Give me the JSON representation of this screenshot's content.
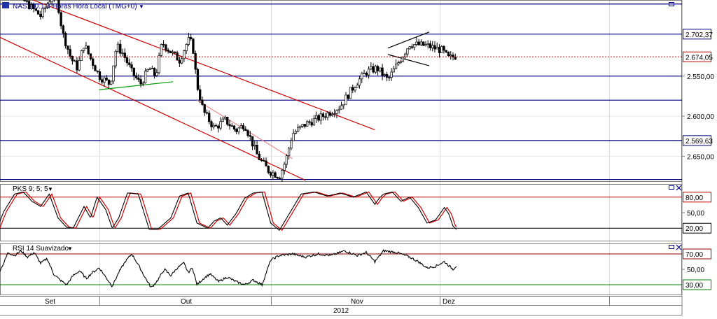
{
  "main_panel": {
    "title": "NAS100.1 4 Horas Hora Local (TMG+0)",
    "price_axis": {
      "ylim": [
        2518,
        2745
      ],
      "ticks": [
        "2.550,00",
        "2.600,00",
        "2.650,00"
      ]
    },
    "h_levels": [
      {
        "value": 2740.0,
        "color": "#000080",
        "label": ""
      },
      {
        "value": 2702.37,
        "color": "#000080",
        "label": "2.702,37"
      },
      {
        "value": 2650.0,
        "color": "#000080",
        "label": ""
      },
      {
        "value": 2620.0,
        "color": "#000080",
        "label": ""
      },
      {
        "value": 2569.63,
        "color": "#000080",
        "label": "2.569,63"
      },
      {
        "value": 2521.0,
        "color": "#000080",
        "label": ""
      }
    ],
    "current_price": {
      "value": 2674.05,
      "label": "2.674,05",
      "color": "#c00000"
    }
  },
  "stochastic_panel": {
    "title": "PKS 9; 5; 5",
    "ylim": [
      0,
      100
    ],
    "levels": [
      {
        "value": 80,
        "label": "80,00",
        "color": "#c00000"
      },
      {
        "value": 20,
        "label": "20,00",
        "color": "#000000"
      }
    ],
    "tick": "50,00",
    "k_color": "#000000",
    "d_color": "#cc0000"
  },
  "rsi_panel": {
    "title": "RSI 14 Suavizado",
    "ylim": [
      20,
      80
    ],
    "levels": [
      {
        "value": 70,
        "label": "70,00",
        "color": "#990000"
      },
      {
        "value": 30,
        "label": "30,00",
        "color": "#008000"
      }
    ],
    "tick": "50,00",
    "line_color": "#000000"
  },
  "time_axis": {
    "months": [
      "Set",
      "Out",
      "Nov",
      "Dez"
    ],
    "year": "2012"
  },
  "chart_data": {
    "type": "candlestick",
    "title": "NAS100.1 4 Horas Hora Local (TMG+0)",
    "ylim": [
      2518,
      2745
    ],
    "price_path": [
      [
        0,
        2780
      ],
      [
        0.06,
        2765
      ],
      [
        0.12,
        2745
      ],
      [
        0.2,
        2725
      ],
      [
        0.23,
        2740
      ],
      [
        0.27,
        2758
      ],
      [
        0.3,
        2705
      ],
      [
        0.34,
        2672
      ],
      [
        0.37,
        2660
      ],
      [
        0.4,
        2690
      ],
      [
        0.43,
        2672
      ],
      [
        0.47,
        2650
      ],
      [
        0.52,
        2640
      ],
      [
        0.55,
        2688
      ],
      [
        0.58,
        2678
      ],
      [
        0.62,
        2655
      ],
      [
        0.66,
        2640
      ],
      [
        0.7,
        2660
      ],
      [
        0.73,
        2650
      ],
      [
        0.76,
        2692
      ],
      [
        0.8,
        2680
      ],
      [
        0.84,
        2670
      ],
      [
        0.88,
        2695
      ],
      [
        0.9,
        2690
      ],
      [
        0.92,
        2640
      ],
      [
        0.95,
        2606
      ],
      [
        1.0,
        2585
      ],
      [
        1.05,
        2595
      ],
      [
        1.1,
        2582
      ],
      [
        1.14,
        2590
      ],
      [
        1.2,
        2550
      ],
      [
        1.25,
        2532
      ],
      [
        1.3,
        2525
      ],
      [
        1.33,
        2545
      ],
      [
        1.36,
        2578
      ],
      [
        1.42,
        2590
      ],
      [
        1.5,
        2600
      ],
      [
        1.58,
        2612
      ],
      [
        1.62,
        2628
      ],
      [
        1.65,
        2640
      ],
      [
        1.7,
        2655
      ],
      [
        1.75,
        2660
      ],
      [
        1.8,
        2645
      ],
      [
        1.85,
        2668
      ],
      [
        1.9,
        2690
      ],
      [
        1.98,
        2688
      ],
      [
        2.05,
        2682
      ],
      [
        2.08,
        2672
      ],
      [
        2.12,
        2676
      ]
    ],
    "drawings": [
      {
        "type": "channel-line",
        "color": "#cc0000",
        "points": [
          [
            0.0,
            2762
          ],
          [
            1.74,
            2583
          ]
        ]
      },
      {
        "type": "channel-line",
        "color": "#cc0000",
        "points": [
          [
            0.0,
            2700
          ],
          [
            1.42,
            2520
          ]
        ]
      },
      {
        "type": "trend-line",
        "color": "#ee8888",
        "points": [
          [
            0.92,
            2620
          ],
          [
            1.36,
            2547
          ]
        ]
      },
      {
        "type": "trend-line",
        "color": "#009900",
        "points": [
          [
            0.47,
            2633
          ],
          [
            0.81,
            2643
          ]
        ]
      },
      {
        "type": "triangle-line",
        "color": "#000000",
        "points": [
          [
            1.8,
            2685
          ],
          [
            1.99,
            2705
          ]
        ]
      },
      {
        "type": "triangle-line",
        "color": "#000000",
        "points": [
          [
            1.8,
            2677
          ],
          [
            1.99,
            2663
          ]
        ]
      }
    ],
    "stochastic_path": [
      [
        0,
        20
      ],
      [
        0.03,
        52
      ],
      [
        0.08,
        86
      ],
      [
        0.12,
        90
      ],
      [
        0.16,
        72
      ],
      [
        0.2,
        62
      ],
      [
        0.24,
        86
      ],
      [
        0.28,
        40
      ],
      [
        0.32,
        22
      ],
      [
        0.35,
        20
      ],
      [
        0.4,
        62
      ],
      [
        0.43,
        40
      ],
      [
        0.46,
        80
      ],
      [
        0.5,
        56
      ],
      [
        0.53,
        20
      ],
      [
        0.56,
        40
      ],
      [
        0.6,
        88
      ],
      [
        0.65,
        86
      ],
      [
        0.7,
        18
      ],
      [
        0.74,
        18
      ],
      [
        0.8,
        40
      ],
      [
        0.84,
        82
      ],
      [
        0.88,
        88
      ],
      [
        0.92,
        30
      ],
      [
        0.97,
        20
      ],
      [
        1.0,
        34
      ],
      [
        1.03,
        40
      ],
      [
        1.06,
        26
      ],
      [
        1.1,
        48
      ],
      [
        1.14,
        78
      ],
      [
        1.18,
        88
      ],
      [
        1.22,
        90
      ],
      [
        1.26,
        30
      ],
      [
        1.3,
        16
      ],
      [
        1.32,
        30
      ],
      [
        1.36,
        58
      ],
      [
        1.4,
        86
      ],
      [
        1.46,
        90
      ],
      [
        1.52,
        82
      ],
      [
        1.58,
        88
      ],
      [
        1.64,
        80
      ],
      [
        1.7,
        90
      ],
      [
        1.74,
        66
      ],
      [
        1.76,
        78
      ],
      [
        1.78,
        86
      ],
      [
        1.82,
        90
      ],
      [
        1.86,
        72
      ],
      [
        1.9,
        80
      ],
      [
        1.94,
        60
      ],
      [
        1.98,
        30
      ],
      [
        2.02,
        36
      ],
      [
        2.06,
        60
      ],
      [
        2.08,
        48
      ],
      [
        2.1,
        24
      ],
      [
        2.12,
        16
      ]
    ],
    "rsi_path": [
      [
        0,
        42
      ],
      [
        0.03,
        58
      ],
      [
        0.05,
        72
      ],
      [
        0.08,
        68
      ],
      [
        0.11,
        74
      ],
      [
        0.14,
        66
      ],
      [
        0.17,
        72
      ],
      [
        0.2,
        58
      ],
      [
        0.23,
        64
      ],
      [
        0.26,
        44
      ],
      [
        0.29,
        36
      ],
      [
        0.32,
        30
      ],
      [
        0.35,
        42
      ],
      [
        0.38,
        48
      ],
      [
        0.41,
        38
      ],
      [
        0.44,
        46
      ],
      [
        0.47,
        52
      ],
      [
        0.5,
        40
      ],
      [
        0.53,
        28
      ],
      [
        0.56,
        46
      ],
      [
        0.59,
        60
      ],
      [
        0.62,
        70
      ],
      [
        0.65,
        56
      ],
      [
        0.68,
        40
      ],
      [
        0.71,
        26
      ],
      [
        0.74,
        36
      ],
      [
        0.77,
        50
      ],
      [
        0.8,
        42
      ],
      [
        0.83,
        52
      ],
      [
        0.86,
        58
      ],
      [
        0.88,
        46
      ],
      [
        0.9,
        52
      ],
      [
        0.92,
        30
      ],
      [
        0.95,
        38
      ],
      [
        0.98,
        44
      ],
      [
        1.02,
        34
      ],
      [
        1.06,
        40
      ],
      [
        1.1,
        34
      ],
      [
        1.14,
        30
      ],
      [
        1.18,
        36
      ],
      [
        1.22,
        30
      ],
      [
        1.26,
        62
      ],
      [
        1.3,
        68
      ],
      [
        1.36,
        70
      ],
      [
        1.42,
        66
      ],
      [
        1.48,
        70
      ],
      [
        1.54,
        68
      ],
      [
        1.6,
        74
      ],
      [
        1.66,
        68
      ],
      [
        1.7,
        72
      ],
      [
        1.74,
        60
      ],
      [
        1.78,
        74
      ],
      [
        1.84,
        72
      ],
      [
        1.9,
        66
      ],
      [
        1.94,
        60
      ],
      [
        1.98,
        52
      ],
      [
        2.02,
        54
      ],
      [
        2.06,
        60
      ],
      [
        2.1,
        50
      ],
      [
        2.12,
        56
      ]
    ]
  }
}
